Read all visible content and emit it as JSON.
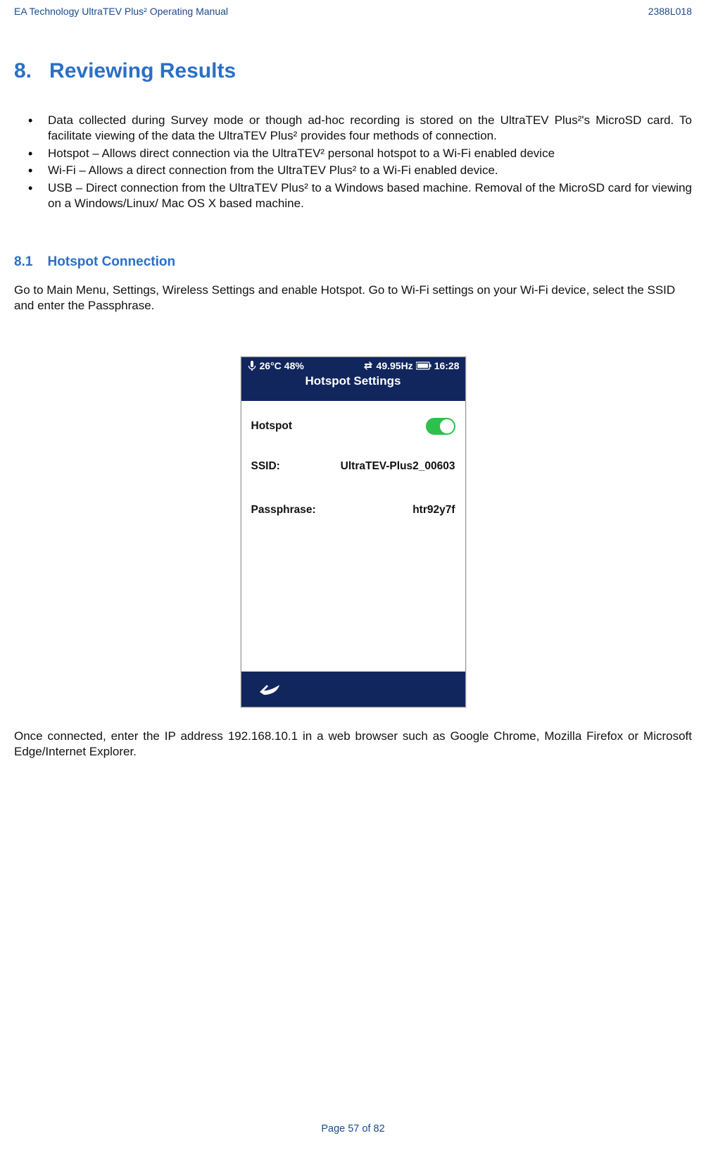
{
  "header": {
    "left": "EA Technology UltraTEV Plus² Operating Manual",
    "right": "2388L018"
  },
  "title": {
    "num": "8.",
    "label": "Reviewing Results"
  },
  "bullets": [
    "Data collected during Survey mode or though ad-hoc recording is stored on the UltraTEV Plus²'s MicroSD card. To facilitate viewing of the data the UltraTEV Plus² provides four methods of connection.",
    "Hotspot – Allows direct connection via the UltraTEV² personal hotspot to a Wi-Fi enabled device",
    "Wi-Fi – Allows a direct connection from the UltraTEV Plus² to a Wi-Fi enabled device.",
    "USB – Direct connection from the UltraTEV Plus² to a Windows based machine. Removal of the MicroSD card for viewing on a Windows/Linux/ Mac OS X based machine."
  ],
  "section": {
    "num": "8.1",
    "label": "Hotspot Connection"
  },
  "para1": "Go to Main Menu, Settings, Wireless Settings and enable Hotspot.  Go to Wi-Fi settings on your Wi-Fi device, select the SSID and enter the Passphrase.",
  "device": {
    "status": {
      "temp": "26°C",
      "pct": "48%",
      "hz": "49.95Hz",
      "time": "16:28"
    },
    "title": "Hotspot Settings",
    "rows": {
      "hotspot_label": "Hotspot",
      "ssid_label": "SSID:",
      "ssid_value": "UltraTEV-Plus2_00603",
      "pass_label": "Passphrase:",
      "pass_value": "htr92y7f"
    }
  },
  "para2": "Once connected, enter the IP address 192.168.10.1 in a web browser such as Google Chrome, Mozilla Firefox or Microsoft Edge/Internet Explorer.",
  "footer": "Page 57 of 82"
}
